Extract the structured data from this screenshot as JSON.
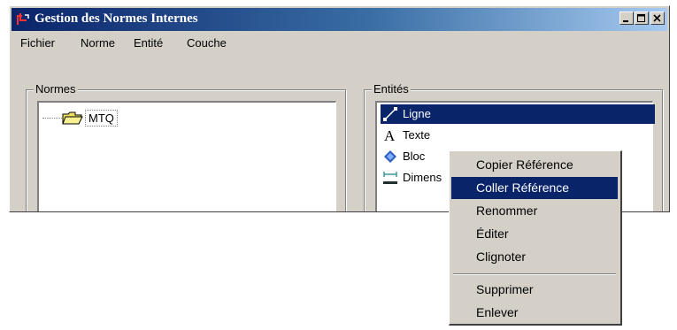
{
  "window": {
    "title": "Gestion des Normes Internes",
    "icon": "app-icon",
    "controls": [
      "minimize-icon",
      "maximize-icon",
      "close-icon"
    ]
  },
  "menubar": {
    "items": [
      "Fichier",
      "Norme",
      "Entité",
      "Couche"
    ]
  },
  "normes": {
    "label": "Normes",
    "tree": [
      {
        "label": "MTQ",
        "icon": "folder-icon"
      }
    ]
  },
  "entites": {
    "label": "Entités",
    "items": [
      {
        "label": "Ligne",
        "icon": "line-icon",
        "selected": true
      },
      {
        "label": "Texte",
        "icon": "text-icon",
        "selected": false
      },
      {
        "label": "Bloc",
        "icon": "block-icon",
        "selected": false
      },
      {
        "label": "Dimens",
        "icon": "dimension-icon",
        "selected": false
      }
    ]
  },
  "context_menu": {
    "items": [
      {
        "label": "Copier  Référence",
        "highlighted": false
      },
      {
        "label": "Coller Référence",
        "highlighted": true
      },
      {
        "label": "Renommer",
        "highlighted": false
      },
      {
        "label": "Éditer",
        "highlighted": false
      },
      {
        "label": "Clignoter",
        "highlighted": false
      },
      {
        "label": "Supprimer",
        "highlighted": false
      },
      {
        "label": "Enlever",
        "highlighted": false
      }
    ]
  },
  "colors": {
    "titlebar_start": "#0a246a",
    "titlebar_end": "#a6caf0",
    "selection": "#0a246a",
    "window_face": "#d4d0c8"
  }
}
